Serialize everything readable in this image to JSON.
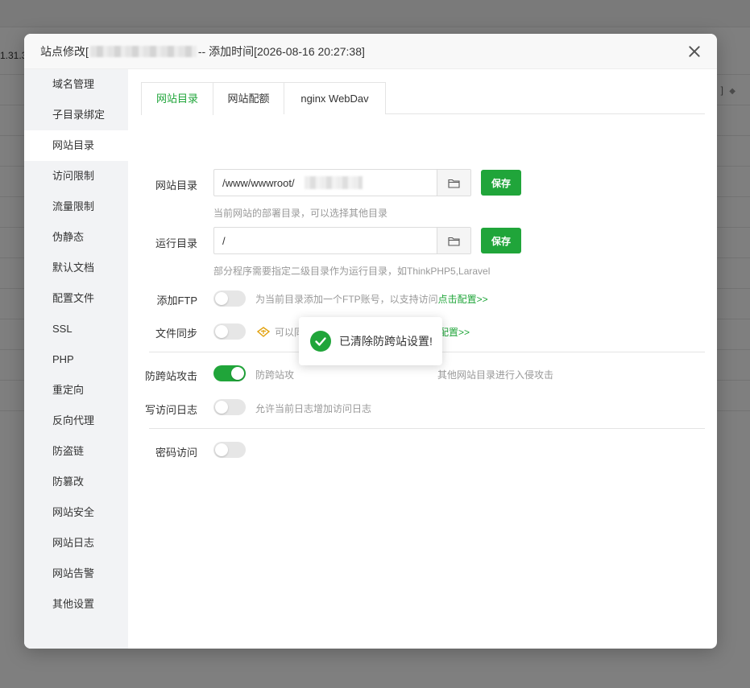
{
  "background": {
    "partial_ip": "1.31.3",
    "corner_text": "]"
  },
  "dialog": {
    "title_prefix": "站点修改[",
    "title_suffix": " -- 添加时间[2026-08-16 20:27:38]"
  },
  "sidebar": {
    "items": [
      {
        "label": "域名管理"
      },
      {
        "label": "子目录绑定"
      },
      {
        "label": "网站目录"
      },
      {
        "label": "访问限制"
      },
      {
        "label": "流量限制"
      },
      {
        "label": "伪静态"
      },
      {
        "label": "默认文档"
      },
      {
        "label": "配置文件"
      },
      {
        "label": "SSL"
      },
      {
        "label": "PHP"
      },
      {
        "label": "重定向"
      },
      {
        "label": "反向代理"
      },
      {
        "label": "防盗链"
      },
      {
        "label": "防篡改"
      },
      {
        "label": "网站安全"
      },
      {
        "label": "网站日志"
      },
      {
        "label": "网站告警"
      },
      {
        "label": "其他设置"
      }
    ],
    "active_index": 2
  },
  "tabs": [
    {
      "label": "网站目录"
    },
    {
      "label": "网站配额"
    },
    {
      "label": "nginx WebDav"
    }
  ],
  "form": {
    "site_dir": {
      "label": "网站目录",
      "value": "/www/wwwroot/",
      "help": "当前网站的部署目录，可以选择其他目录",
      "save_label": "保存"
    },
    "run_dir": {
      "label": "运行目录",
      "value": "/",
      "help": "部分程序需要指定二级目录作为运行目录，如ThinkPHP5,Laravel",
      "save_label": "保存"
    },
    "ftp": {
      "label": "添加FTP",
      "desc": "为当前目录添加一个FTP账号，以支持访问",
      "link": "点击配置>>",
      "enabled": false
    },
    "sync": {
      "label": "文件同步",
      "desc": "可以同步网站文件至其他服务节点",
      "link": "点击配置>>",
      "enabled": false
    },
    "anti_cross": {
      "label": "防跨站攻击",
      "desc_left": "防跨站攻",
      "desc_right": "其他网站目录进行入侵攻击",
      "enabled": true
    },
    "access_log": {
      "label": "写访问日志",
      "desc": "允许当前日志增加访问日志",
      "enabled": false
    },
    "password": {
      "label": "密码访问",
      "enabled": false
    }
  },
  "toast": {
    "message": "已清除防跨站设置!"
  },
  "colors": {
    "accent": "#20a53a",
    "warning_icon": "#e2a10d"
  }
}
